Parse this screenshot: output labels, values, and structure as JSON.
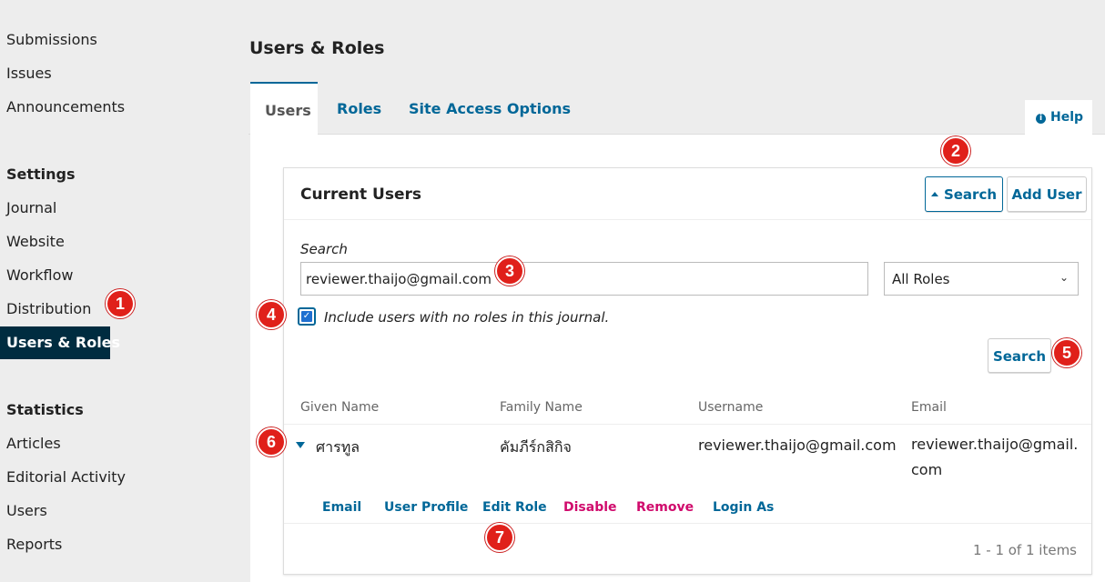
{
  "sidebar": {
    "items_top": [
      {
        "label": "Submissions"
      },
      {
        "label": "Issues"
      },
      {
        "label": "Announcements"
      }
    ],
    "settings_heading": "Settings",
    "settings_items": [
      {
        "label": "Journal"
      },
      {
        "label": "Website"
      },
      {
        "label": "Workflow"
      },
      {
        "label": "Distribution"
      }
    ],
    "active_item": "Users & Roles",
    "statistics_heading": "Statistics",
    "statistics_items": [
      {
        "label": "Articles"
      },
      {
        "label": "Editorial Activity"
      },
      {
        "label": "Users"
      },
      {
        "label": "Reports"
      }
    ]
  },
  "header": {
    "title": "Users & Roles"
  },
  "tabs": [
    {
      "label": "Users"
    },
    {
      "label": "Roles"
    },
    {
      "label": "Site Access Options"
    }
  ],
  "help_label": "Help",
  "panel": {
    "title": "Current Users",
    "search_toggle_label": "Search",
    "add_user_label": "Add User",
    "search_label": "Search",
    "search_value": "reviewer.thaijo@gmail.com",
    "roles_selected": "All Roles",
    "checkbox_checked": true,
    "checkbox_label": "Include users with no roles in this journal.",
    "search_submit_label": "Search"
  },
  "table": {
    "headers": [
      "Given Name",
      "Family Name",
      "Username",
      "Email"
    ],
    "rows": [
      {
        "given_name": "ศารทูล",
        "family_name": "คัมภีร์กสิกิจ",
        "username": "reviewer.thaijo@gmail.com",
        "email": "reviewer.thaijo@gmail.com"
      }
    ],
    "actions": [
      "Email",
      "User Profile",
      "Edit Role",
      "Disable",
      "Remove",
      "Login As"
    ]
  },
  "pagination": "1 - 1 of 1 items",
  "markers": [
    "1",
    "2",
    "3",
    "4",
    "5",
    "6",
    "7"
  ],
  "colors": {
    "accent": "#006798",
    "danger_link": "#d00a6c",
    "sidebar_active_bg": "#002c40",
    "marker": "#e0201a"
  }
}
